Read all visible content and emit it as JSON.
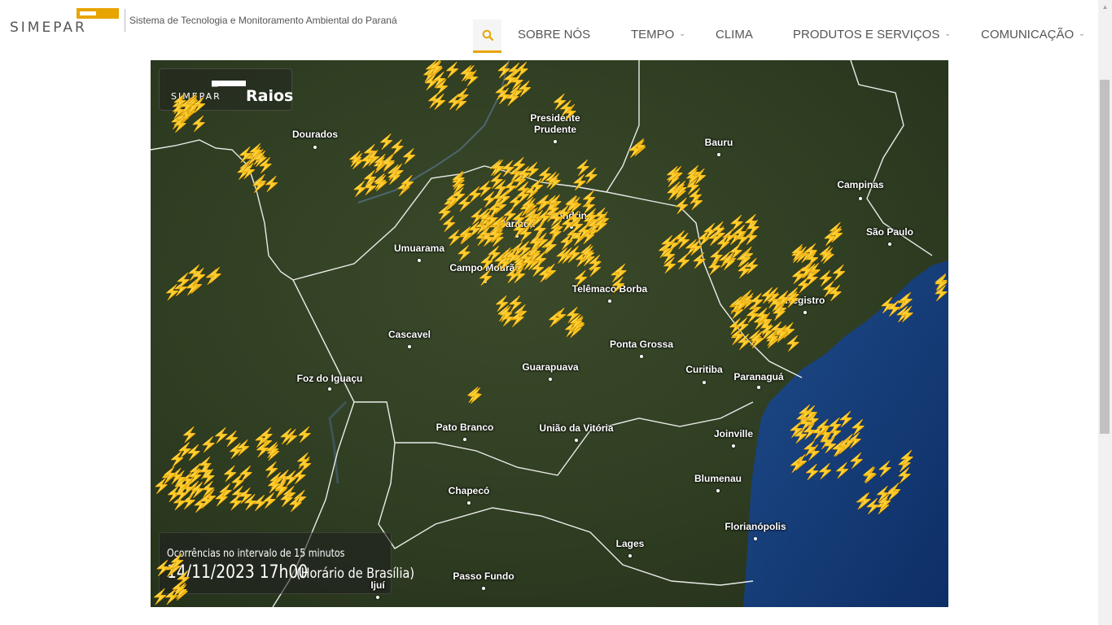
{
  "header": {
    "logo_text": "SIMEPAR",
    "tagline": "Sistema de Tecnologia e Monitoramento Ambiental do Paraná",
    "brand_color": "#e8a400",
    "nav": [
      {
        "label": "SOBRE NÓS",
        "has_dropdown": false
      },
      {
        "label": "TEMPO",
        "has_dropdown": true
      },
      {
        "label": "CLIMA",
        "has_dropdown": false
      },
      {
        "label": "PRODUTOS E SERVIÇOS",
        "has_dropdown": true
      },
      {
        "label": "COMUNICAÇÃO",
        "has_dropdown": true
      }
    ],
    "search_icon": "search-icon"
  },
  "map": {
    "badge_logo": "SIMEPAR",
    "badge_title": "Raios",
    "bolt_color": "#f2b705",
    "caption": "Ocorrências no intervalo de 15 minutos",
    "datetime": "14/11/2023 17h00",
    "timezone": "(Horário de Brasília)",
    "cities": [
      "Dourados",
      "Presidente Prudente",
      "Bauru",
      "Campinas",
      "São Paulo",
      "Umuarama",
      "Maringá",
      "Londrina",
      "Campo Mourão",
      "Telêmaco Borba",
      "Registro",
      "Cascavel",
      "Ponta Grossa",
      "Guarapuava",
      "Curitiba",
      "Paranaguá",
      "Foz do Iguaçu",
      "Pato Branco",
      "União da Vitória",
      "Joinville",
      "Chapecó",
      "Blumenau",
      "Florianópolis",
      "Lages",
      "Passo Fundo",
      "Ijuí"
    ]
  }
}
